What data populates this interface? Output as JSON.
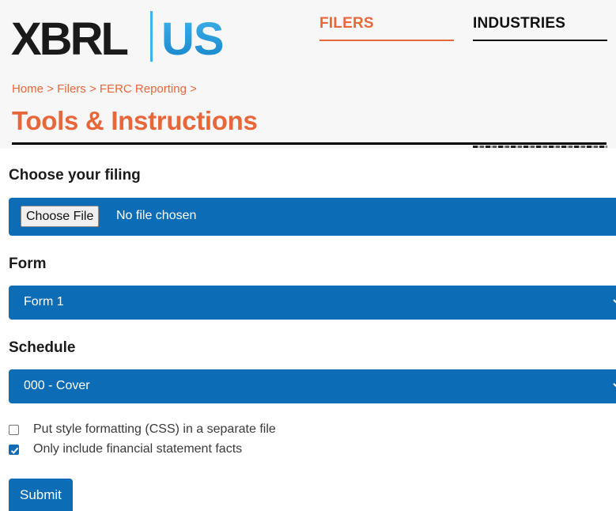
{
  "logo": {
    "text_left": "XBRL",
    "text_right": "US"
  },
  "nav": {
    "filers": "FILERS",
    "industries": "INDUSTRIES"
  },
  "breadcrumb": {
    "home": "Home",
    "filers": "Filers",
    "ferc": "FERC Reporting",
    "separator": ">"
  },
  "page_title": "Tools & Instructions",
  "form": {
    "filing_label": "Choose your filing",
    "choose_file_button": "Choose File",
    "no_file_text": "No file chosen",
    "form_label": "Form",
    "form_selected": "Form 1",
    "schedule_label": "Schedule",
    "schedule_selected": "000 - Cover",
    "checkbox_css_label": "Put style formatting (CSS) in a separate file",
    "checkbox_css_checked": false,
    "checkbox_fin_label": "Only include financial statement facts",
    "checkbox_fin_checked": true,
    "submit_label": "Submit"
  },
  "colors": {
    "accent": "#e8673a",
    "primary": "#0c6cb5",
    "header_bg": "#f7f7f7"
  },
  "icons": [
    "chevron-down-icon",
    "checkmark-icon"
  ]
}
